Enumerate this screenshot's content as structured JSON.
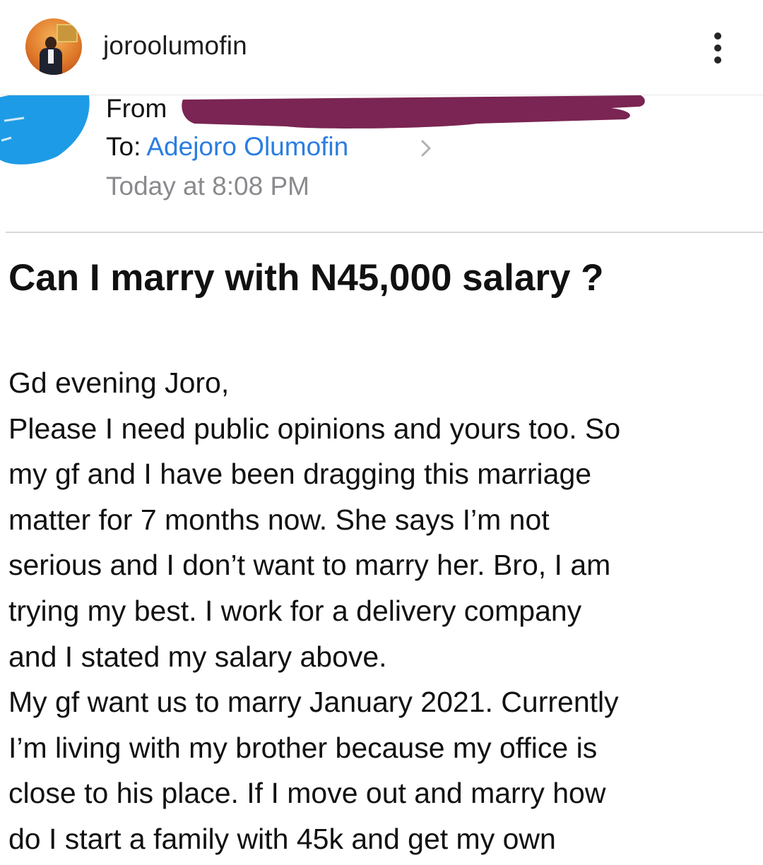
{
  "post_header": {
    "username": "joroolumofin",
    "avatar_icon": "profile-photo",
    "menu_icon": "more-vertical-icon"
  },
  "email": {
    "from_label": "From",
    "to_label": "To:",
    "to_name": "Adejoro Olumofin",
    "date": "Today at 8:08 PM",
    "subject": "Can I marry with N45,000 salary ?",
    "body_lines": [
      "Gd evening Joro,",
      "Please I need public opinions and yours too. So",
      "my gf and I have been dragging this marriage",
      "matter for 7 months now. She says I’m not",
      "serious and I don’t want to marry her. Bro, I am",
      "trying my best. I work for a delivery company",
      "and I stated my salary above.",
      "My gf want us to marry January 2021. Currently",
      "I’m living with my brother because my office is",
      "close to his place. If I move out and marry how",
      "do I start a family with 45k and get my own"
    ]
  },
  "colors": {
    "link_blue": "#2a7de1",
    "redaction_purple": "#7a2553",
    "scribble_blue": "#1e9be6",
    "muted_gray": "#8a8a8e"
  }
}
